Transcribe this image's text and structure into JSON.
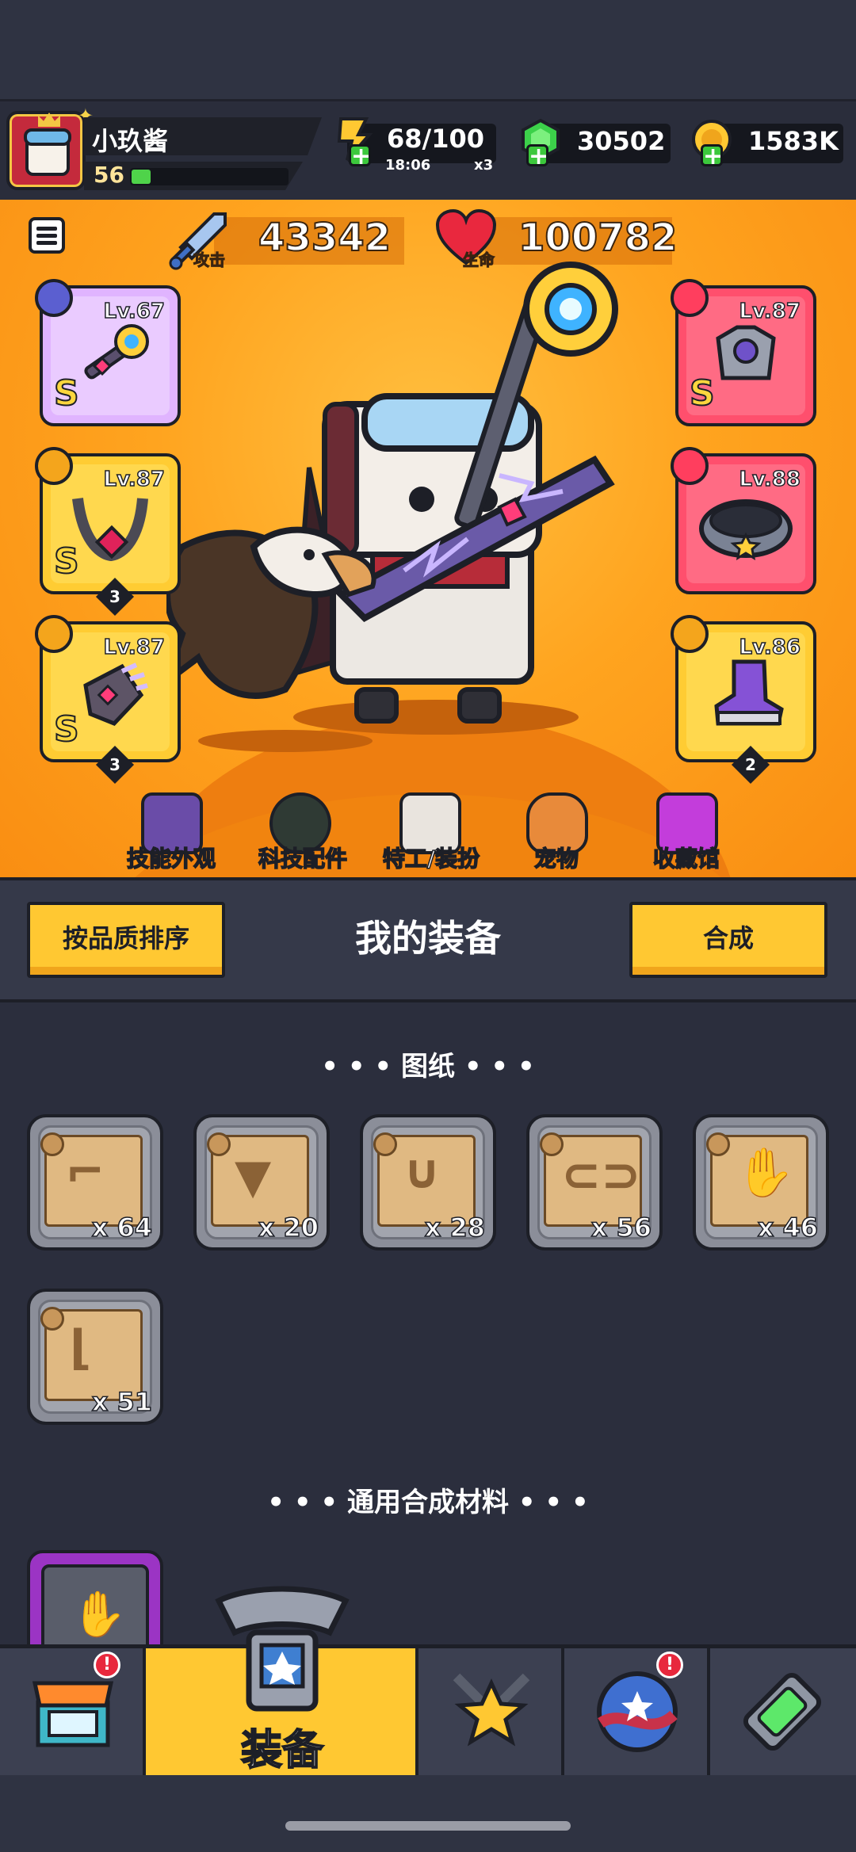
{
  "player": {
    "name": "小玖酱",
    "level": "56",
    "xp_fraction": 0.12
  },
  "resources": {
    "stamina": {
      "value": "68/100",
      "timer": "18:06",
      "multiplier": "x3"
    },
    "gems": {
      "value": "30502"
    },
    "coins": {
      "value": "1583K"
    }
  },
  "stats": {
    "attack": {
      "label": "攻击",
      "value": "43342"
    },
    "health": {
      "label": "生命",
      "value": "100782"
    }
  },
  "equipment_slots": {
    "weapon": {
      "level": "Lv.67",
      "grade": "S"
    },
    "necklace": {
      "level": "Lv.87",
      "grade": "S",
      "count": "3"
    },
    "glove": {
      "level": "Lv.87",
      "grade": "S",
      "count": "3"
    },
    "armor": {
      "level": "Lv.87",
      "grade": "S"
    },
    "belt": {
      "level": "Lv.88"
    },
    "boots": {
      "level": "Lv.86",
      "count": "2"
    }
  },
  "feature_nav": [
    {
      "label": "技能外观",
      "icon": "skill-skin-icon"
    },
    {
      "label": "科技配件",
      "icon": "tech-part-icon"
    },
    {
      "label": "特工/装扮",
      "icon": "agent-costume-icon"
    },
    {
      "label": "宠物",
      "icon": "pet-dog-icon"
    },
    {
      "label": "收藏馆",
      "icon": "collection-chest-icon"
    }
  ],
  "equipment_panel": {
    "sort_button": "按品质排序",
    "title": "我的装备",
    "merge_button": "合成"
  },
  "blueprints": {
    "section_title": "• • •  图纸  • • •",
    "items": [
      {
        "icon": "pistol-icon",
        "qty": "x 64"
      },
      {
        "icon": "shirt-icon",
        "qty": "x 20"
      },
      {
        "icon": "necklace-icon",
        "qty": "x 28"
      },
      {
        "icon": "belt-icon",
        "qty": "x 56"
      },
      {
        "icon": "glove-icon",
        "qty": "x 46"
      },
      {
        "icon": "boots-icon",
        "qty": "x 51"
      }
    ]
  },
  "materials": {
    "section_title": "• • •  通用合成材料  • • •"
  },
  "tabbar": {
    "tabs": [
      {
        "icon": "shop-icon",
        "alert": "!"
      },
      {
        "icon": "equipment-icon",
        "label": "装备"
      },
      {
        "icon": "battle-star-icon"
      },
      {
        "icon": "star-orb-icon",
        "alert": "!"
      },
      {
        "icon": "dna-capsule-icon"
      }
    ]
  },
  "colors": {
    "accent": "#ffc832",
    "stage": "#ffa41f",
    "panel": "#2b2e3d",
    "legendary": "#ff4f6d",
    "epic": "#e6b0ff"
  }
}
